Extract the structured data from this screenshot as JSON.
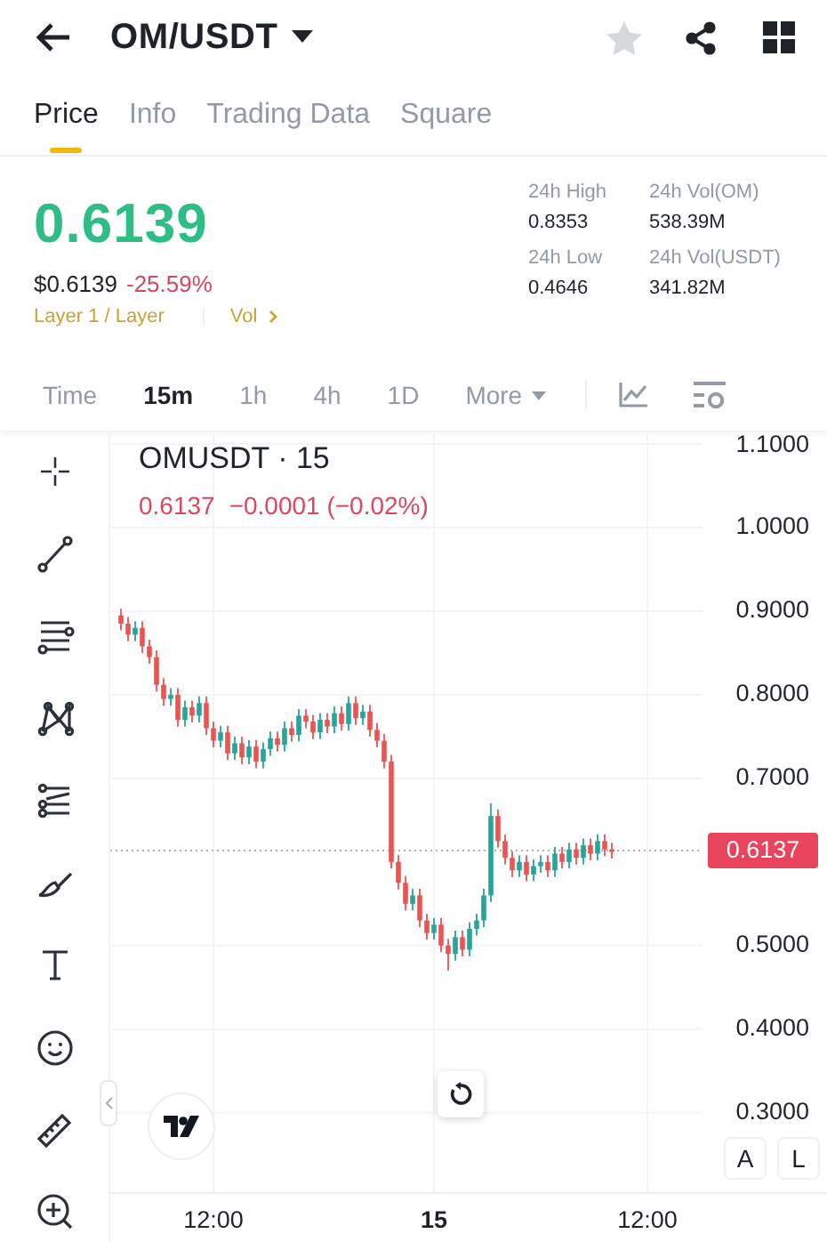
{
  "header": {
    "title": "OM/USDT",
    "favorite": false
  },
  "tabs": [
    {
      "label": "Price",
      "selected": true
    },
    {
      "label": "Info",
      "selected": false
    },
    {
      "label": "Trading Data",
      "selected": false
    },
    {
      "label": "Square",
      "selected": false
    }
  ],
  "price": {
    "last": "0.6139",
    "usd": "$0.6139",
    "change": "-25.59%",
    "category": "Layer 1 / Layer",
    "link": "Vol",
    "stats": [
      {
        "label": "24h High",
        "value": "0.8353"
      },
      {
        "label": "24h Vol(OM)",
        "value": "538.39M"
      },
      {
        "label": "24h Low",
        "value": "0.4646"
      },
      {
        "label": "24h Vol(USDT)",
        "value": "341.82M"
      }
    ]
  },
  "intervals": [
    {
      "label": "Time",
      "selected": false,
      "kind": "plain"
    },
    {
      "label": "15m",
      "selected": true,
      "kind": "plain"
    },
    {
      "label": "1h",
      "selected": false,
      "kind": "plain"
    },
    {
      "label": "4h",
      "selected": false,
      "kind": "plain"
    },
    {
      "label": "1D",
      "selected": false,
      "kind": "plain"
    },
    {
      "label": "More",
      "selected": false,
      "kind": "menu"
    }
  ],
  "chart": {
    "symbol": "OMUSDT · 15",
    "last": "0.6137",
    "change": "−0.0001 (−0.02%)",
    "x_tick_styles": [
      {
        "kind": "time"
      },
      {
        "kind": "day"
      },
      {
        "kind": "time"
      }
    ],
    "chart_data": {
      "type": "candlestick",
      "ylim": [
        0.205,
        1.116
      ],
      "grid": true,
      "categories": [
        null,
        null,
        null,
        null,
        null,
        null,
        null,
        null,
        null,
        null,
        null,
        null,
        null,
        "12:00",
        null,
        null,
        null,
        null,
        null,
        null,
        null,
        null,
        null,
        null,
        null,
        null,
        null,
        null,
        null,
        null,
        null,
        null,
        null,
        null,
        null,
        null,
        null,
        null,
        null,
        null,
        null,
        null,
        null,
        null,
        "15",
        null,
        null,
        null,
        null,
        null,
        null,
        null,
        null,
        null,
        null,
        null,
        null,
        null,
        null,
        null,
        null,
        null,
        null,
        null,
        null,
        null,
        null,
        null,
        null,
        null,
        null,
        null,
        null,
        null,
        "12:00",
        null
      ],
      "ref_lines": [
        {
          "axis": "y",
          "value": 0.6137,
          "label": "0.6137"
        }
      ],
      "yticks": [
        {
          "value": 1.1,
          "label": "1.1000"
        },
        {
          "value": 1.0,
          "label": "1.0000"
        },
        {
          "value": 0.9,
          "label": "0.9000"
        },
        {
          "value": 0.8,
          "label": "0.8000"
        },
        {
          "value": 0.7,
          "label": "0.7000"
        },
        {
          "value": 0.5,
          "label": "0.5000"
        },
        {
          "value": 0.4,
          "label": "0.4000"
        },
        {
          "value": 0.3,
          "label": "0.3000"
        }
      ],
      "ohlc": [
        [
          0.895,
          0.903,
          0.877,
          0.885
        ],
        [
          0.885,
          0.893,
          0.864,
          0.872
        ],
        [
          0.872,
          0.888,
          0.864,
          0.88
        ],
        [
          0.88,
          0.888,
          0.85,
          0.858
        ],
        [
          0.858,
          0.866,
          0.837,
          0.845
        ],
        [
          0.845,
          0.853,
          0.804,
          0.812
        ],
        [
          0.812,
          0.82,
          0.787,
          0.795
        ],
        [
          0.795,
          0.808,
          0.787,
          0.8
        ],
        [
          0.8,
          0.808,
          0.762,
          0.77
        ],
        [
          0.77,
          0.793,
          0.762,
          0.785
        ],
        [
          0.785,
          0.793,
          0.767,
          0.775
        ],
        [
          0.775,
          0.798,
          0.767,
          0.79
        ],
        [
          0.79,
          0.798,
          0.752,
          0.76
        ],
        [
          0.76,
          0.768,
          0.737,
          0.745
        ],
        [
          0.745,
          0.763,
          0.737,
          0.755
        ],
        [
          0.755,
          0.763,
          0.722,
          0.73
        ],
        [
          0.73,
          0.75,
          0.722,
          0.742
        ],
        [
          0.742,
          0.75,
          0.717,
          0.725
        ],
        [
          0.725,
          0.746,
          0.717,
          0.738
        ],
        [
          0.738,
          0.746,
          0.712,
          0.72
        ],
        [
          0.72,
          0.743,
          0.712,
          0.735
        ],
        [
          0.735,
          0.756,
          0.727,
          0.748
        ],
        [
          0.748,
          0.756,
          0.732,
          0.74
        ],
        [
          0.74,
          0.768,
          0.732,
          0.76
        ],
        [
          0.76,
          0.768,
          0.744,
          0.752
        ],
        [
          0.752,
          0.783,
          0.744,
          0.775
        ],
        [
          0.775,
          0.783,
          0.76,
          0.768
        ],
        [
          0.768,
          0.776,
          0.747,
          0.755
        ],
        [
          0.755,
          0.778,
          0.747,
          0.77
        ],
        [
          0.77,
          0.778,
          0.754,
          0.762
        ],
        [
          0.762,
          0.786,
          0.754,
          0.778
        ],
        [
          0.778,
          0.786,
          0.757,
          0.765
        ],
        [
          0.765,
          0.798,
          0.757,
          0.79
        ],
        [
          0.79,
          0.798,
          0.764,
          0.772
        ],
        [
          0.772,
          0.788,
          0.764,
          0.78
        ],
        [
          0.78,
          0.788,
          0.75,
          0.758
        ],
        [
          0.758,
          0.766,
          0.737,
          0.745
        ],
        [
          0.745,
          0.753,
          0.712,
          0.72
        ],
        [
          0.72,
          0.728,
          0.592,
          0.6
        ],
        [
          0.6,
          0.608,
          0.567,
          0.575
        ],
        [
          0.575,
          0.583,
          0.542,
          0.55
        ],
        [
          0.55,
          0.568,
          0.542,
          0.56
        ],
        [
          0.56,
          0.568,
          0.522,
          0.53
        ],
        [
          0.53,
          0.538,
          0.507,
          0.515
        ],
        [
          0.515,
          0.533,
          0.507,
          0.525
        ],
        [
          0.525,
          0.533,
          0.492,
          0.5
        ],
        [
          0.5,
          0.508,
          0.47,
          0.49
        ],
        [
          0.49,
          0.518,
          0.482,
          0.51
        ],
        [
          0.51,
          0.518,
          0.487,
          0.495
        ],
        [
          0.495,
          0.528,
          0.487,
          0.52
        ],
        [
          0.52,
          0.538,
          0.512,
          0.53
        ],
        [
          0.53,
          0.568,
          0.522,
          0.56
        ],
        [
          0.56,
          0.67,
          0.552,
          0.655
        ],
        [
          0.655,
          0.663,
          0.617,
          0.625
        ],
        [
          0.625,
          0.633,
          0.597,
          0.605
        ],
        [
          0.605,
          0.613,
          0.582,
          0.59
        ],
        [
          0.59,
          0.608,
          0.582,
          0.6
        ],
        [
          0.6,
          0.608,
          0.577,
          0.585
        ],
        [
          0.585,
          0.603,
          0.577,
          0.595
        ],
        [
          0.595,
          0.608,
          0.587,
          0.6
        ],
        [
          0.6,
          0.608,
          0.582,
          0.59
        ],
        [
          0.59,
          0.618,
          0.582,
          0.61
        ],
        [
          0.61,
          0.618,
          0.592,
          0.6
        ],
        [
          0.6,
          0.623,
          0.592,
          0.615
        ],
        [
          0.615,
          0.623,
          0.597,
          0.605
        ],
        [
          0.605,
          0.628,
          0.597,
          0.62
        ],
        [
          0.62,
          0.628,
          0.602,
          0.61
        ],
        [
          0.61,
          0.633,
          0.602,
          0.625
        ],
        [
          0.625,
          0.633,
          0.607,
          0.615
        ],
        [
          0.615,
          0.623,
          0.604,
          0.612
        ],
        null,
        null,
        null,
        null,
        null,
        null
      ]
    },
    "scale_buttons": [
      "A",
      "L"
    ]
  }
}
